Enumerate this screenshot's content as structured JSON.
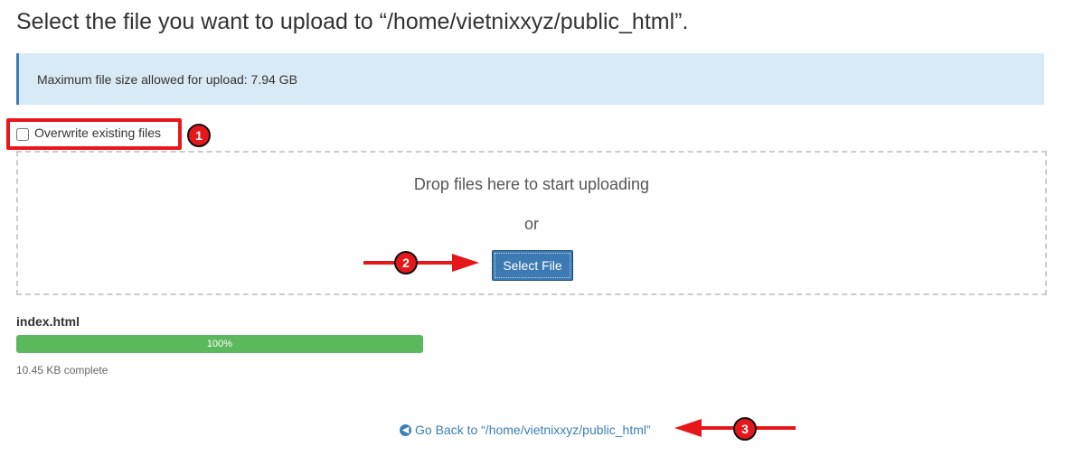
{
  "header": {
    "title": "Select the file you want to upload to “/home/vietnixxyz/public_html”."
  },
  "info": {
    "max_file_size": "Maximum file size allowed for upload: 7.94 GB"
  },
  "options": {
    "overwrite_label": "Overwrite existing files",
    "overwrite_checked": false
  },
  "drop_zone": {
    "drop_text": "Drop files here to start uploading",
    "or_text": "or",
    "select_button_label": "Select File"
  },
  "upload": {
    "file_name": "index.html",
    "progress_label": "100%",
    "progress_fraction": 1.0,
    "status_text": "10.45 KB complete"
  },
  "footer": {
    "back_link_label": "Go Back to “/home/vietnixxyz/public_html”"
  },
  "annotations": {
    "badge_1": "1",
    "badge_2": "2",
    "badge_3": "3"
  },
  "colors": {
    "accent": "#3a7fb8",
    "info_bg": "#d9eaf7",
    "success": "#5cb85c",
    "annotation_red": "#e5171a"
  }
}
